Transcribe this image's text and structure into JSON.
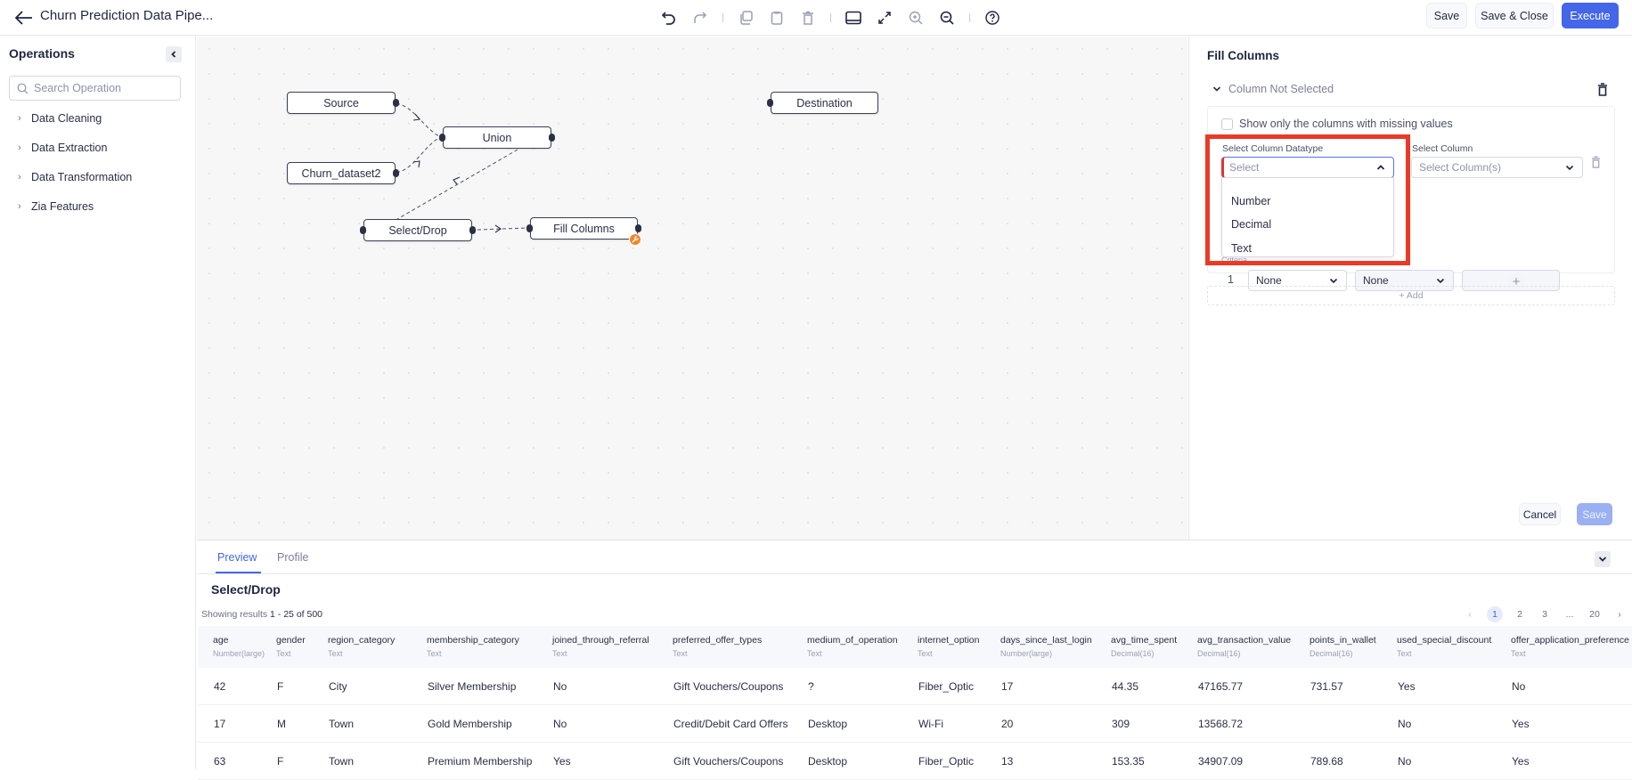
{
  "header": {
    "title": "Churn Prediction Data Pipe...",
    "buttons": {
      "save": "Save",
      "save_close": "Save & Close",
      "execute": "Execute"
    },
    "toolbar_icons": [
      "undo-icon",
      "redo-icon",
      "copy-icon",
      "paste-icon",
      "delete-icon",
      "toggle-panel-icon",
      "fit-screen-icon",
      "zoom-in-icon",
      "zoom-out-icon",
      "help-icon"
    ]
  },
  "colors": {
    "accent": "#4466e8",
    "highlight": "#ea3a26",
    "badge": "#f0872a"
  },
  "sidebar": {
    "title": "Operations",
    "search_placeholder": "Search Operation",
    "items": [
      {
        "label": "Data Cleaning"
      },
      {
        "label": "Data Extraction"
      },
      {
        "label": "Data Transformation"
      },
      {
        "label": "Zia Features"
      }
    ]
  },
  "canvas": {
    "nodes": [
      {
        "id": "source",
        "label": "Source"
      },
      {
        "id": "churn",
        "label": "Churn_dataset2"
      },
      {
        "id": "union",
        "label": "Union"
      },
      {
        "id": "selectdrop",
        "label": "Select/Drop"
      },
      {
        "id": "fill",
        "label": "Fill Columns"
      },
      {
        "id": "dest",
        "label": "Destination"
      }
    ],
    "edges": [
      [
        "source",
        "union"
      ],
      [
        "churn",
        "union"
      ],
      [
        "union",
        "selectdrop"
      ],
      [
        "selectdrop",
        "fill"
      ]
    ]
  },
  "panel": {
    "title": "Fill Columns",
    "accordion_label": "Column Not Selected",
    "checkbox_label": "Show only the columns with missing values",
    "datatype_label": "Select Column Datatype",
    "datatype_placeholder": "Select",
    "datatype_options": [
      "Number",
      "Decimal",
      "Text"
    ],
    "column_label": "Select Column",
    "column_placeholder": "Select Column(s)",
    "criteria_label": "Criteria",
    "criteria_row": {
      "index": "1",
      "first": "None",
      "second": "None",
      "value": ""
    },
    "add_label": "+ Add",
    "cancel": "Cancel",
    "save": "Save"
  },
  "bottom": {
    "tabs": [
      {
        "label": "Preview",
        "active": true
      },
      {
        "label": "Profile",
        "active": false
      }
    ],
    "title": "Select/Drop",
    "showing_prefix": "Showing results",
    "showing_range": "1 - 25 of 500",
    "pagination": {
      "prev": "‹",
      "pages": [
        "1",
        "2",
        "3",
        "...",
        "20"
      ],
      "current": "1",
      "next": "›"
    },
    "columns": [
      {
        "name": "age",
        "type": "Number(large)"
      },
      {
        "name": "gender",
        "type": "Text"
      },
      {
        "name": "region_category",
        "type": "Text"
      },
      {
        "name": "membership_category",
        "type": "Text"
      },
      {
        "name": "joined_through_referral",
        "type": "Text"
      },
      {
        "name": "preferred_offer_types",
        "type": "Text"
      },
      {
        "name": "medium_of_operation",
        "type": "Text"
      },
      {
        "name": "internet_option",
        "type": "Text"
      },
      {
        "name": "days_since_last_login",
        "type": "Number(large)"
      },
      {
        "name": "avg_time_spent",
        "type": "Decimal(16)"
      },
      {
        "name": "avg_transaction_value",
        "type": "Decimal(16)"
      },
      {
        "name": "points_in_wallet",
        "type": "Decimal(16)"
      },
      {
        "name": "used_special_discount",
        "type": "Text"
      },
      {
        "name": "offer_application_preference",
        "type": "Text"
      }
    ],
    "rows": [
      [
        "42",
        "F",
        "City",
        "Silver Membership",
        "No",
        "Gift Vouchers/Coupons",
        "?",
        "Fiber_Optic",
        "17",
        "44.35",
        "47165.77",
        "731.57",
        "Yes",
        "No"
      ],
      [
        "17",
        "M",
        "Town",
        "Gold Membership",
        "No",
        "Credit/Debit Card Offers",
        "Desktop",
        "Wi-Fi",
        "20",
        "309",
        "13568.72",
        "",
        "No",
        "Yes"
      ],
      [
        "63",
        "F",
        "Town",
        "Premium Membership",
        "Yes",
        "Gift Vouchers/Coupons",
        "Desktop",
        "Fiber_Optic",
        "13",
        "153.35",
        "34907.09",
        "789.68",
        "No",
        "Yes"
      ]
    ]
  }
}
